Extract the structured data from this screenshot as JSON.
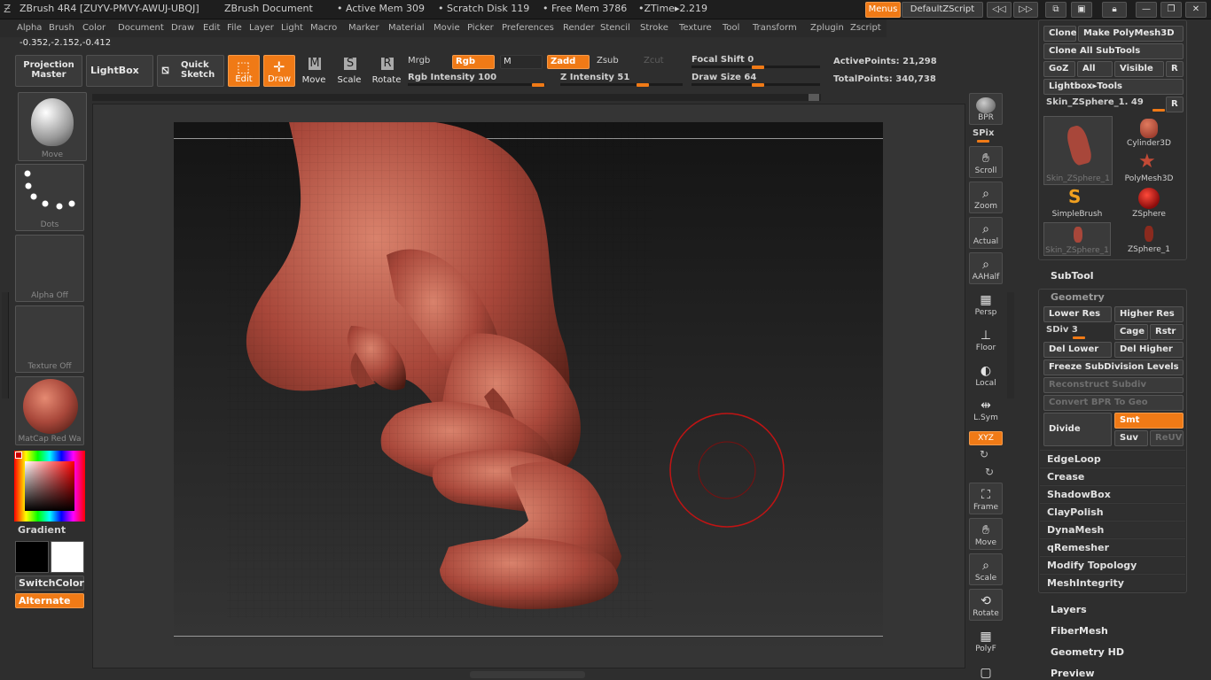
{
  "title": {
    "app": "ZBrush 4R4 [ZUYV-PMVY-AWUJ-UBQJ]",
    "document": "ZBrush Document",
    "active_mem": "• Active Mem 309",
    "scratch": "• Scratch Disk 119",
    "free_mem": "• Free Mem 3786",
    "ztime": "•ZTime▸2.219",
    "menus_btn": "Menus",
    "script_btn": "DefaultZScript"
  },
  "menu": [
    "Alpha",
    "Brush",
    "Color",
    "Document",
    "Draw",
    "Edit",
    "File",
    "Layer",
    "Light",
    "Macro",
    "Marker",
    "Material",
    "Movie",
    "Picker",
    "Preferences",
    "Render",
    "Stencil",
    "Stroke",
    "Texture",
    "Tool",
    "Transform",
    "Zplugin",
    "Zscript"
  ],
  "coords": "-0.352,-2.152,-0.412",
  "toolbar": {
    "projection_master": "Projection Master",
    "lightbox": "LightBox",
    "quick_sketch": "Quick Sketch",
    "edit": "Edit",
    "draw": "Draw",
    "move": "Move",
    "scale": "Scale",
    "rotate": "Rotate",
    "mrgb": "Mrgb",
    "rgb": "Rgb",
    "m": "M",
    "zadd": "Zadd",
    "zsub": "Zsub",
    "zcut": "Zcut",
    "rgb_intensity": "Rgb Intensity 100",
    "z_intensity": "Z Intensity 51",
    "focal_shift": "Focal Shift 0",
    "draw_size": "Draw Size 64",
    "active_points": "ActivePoints: 21,298",
    "total_points": "TotalPoints: 340,738"
  },
  "left": {
    "brush": "Move",
    "stroke": "Dots",
    "alpha": "Alpha Off",
    "texture": "Texture Off",
    "material": "MatCap Red Wa",
    "gradient": "Gradient",
    "switch_color": "SwitchColor",
    "alternate": "Alternate"
  },
  "shelf": [
    "BPR",
    "SPix",
    "Scroll",
    "Zoom",
    "Actual",
    "AAHalf",
    "Persp",
    "Floor",
    "Local",
    "L.Sym",
    "XYZ",
    "Frame",
    "Move",
    "Scale",
    "Rotate",
    "PolyF"
  ],
  "tool": {
    "clone": "Clone",
    "make_polymesh": "Make PolyMesh3D",
    "clone_all": "Clone All SubTools",
    "goz": "GoZ",
    "all": "All",
    "visible": "Visible",
    "r": "R",
    "lightbox_tools": "Lightbox▸Tools",
    "current": "Skin_ZSphere_1. 49",
    "thumbs": [
      "Skin_ZSphere_1",
      "Cylinder3D",
      "PolyMesh3D",
      "SimpleBrush",
      "ZSphere",
      "Skin_ZSphere_1",
      "ZSphere_1"
    ],
    "subtool": "SubTool"
  },
  "geometry": {
    "header": "Geometry",
    "lower_res": "Lower Res",
    "higher_res": "Higher Res",
    "sdiv": "SDiv 3",
    "cage": "Cage",
    "rstr": "Rstr",
    "del_lower": "Del Lower",
    "del_higher": "Del Higher",
    "freeze": "Freeze SubDivision Levels",
    "reconstruct": "Reconstruct Subdiv",
    "convert_bpr": "Convert BPR To Geo",
    "divide": "Divide",
    "smt": "Smt",
    "suv": "Suv",
    "reuv": "ReUV",
    "items": [
      "EdgeLoop",
      "Crease",
      "ShadowBox",
      "ClayPolish",
      "DynaMesh",
      "qRemesher",
      "Modify Topology",
      "MeshIntegrity"
    ]
  },
  "sections": [
    "Layers",
    "FiberMesh",
    "Geometry HD",
    "Preview"
  ],
  "colors": {
    "accent": "#f07a16",
    "model": "#a8473a"
  }
}
